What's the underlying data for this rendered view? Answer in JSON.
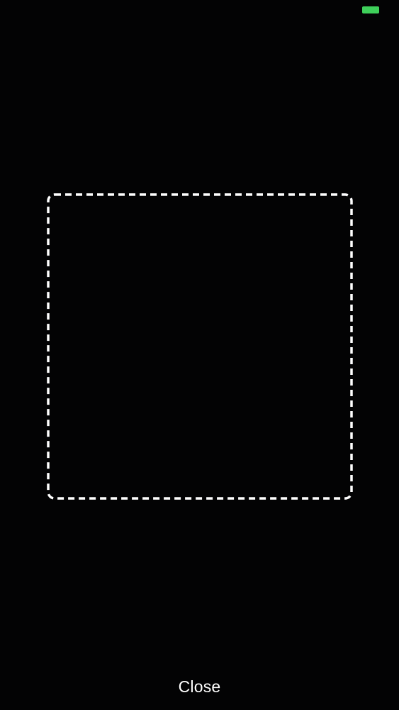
{
  "status": {
    "indicator_color": "#3ecf5a"
  },
  "scanner": {
    "frame_color": "#ffffff",
    "frame_style": "dashed"
  },
  "footer": {
    "close_label": "Close"
  }
}
